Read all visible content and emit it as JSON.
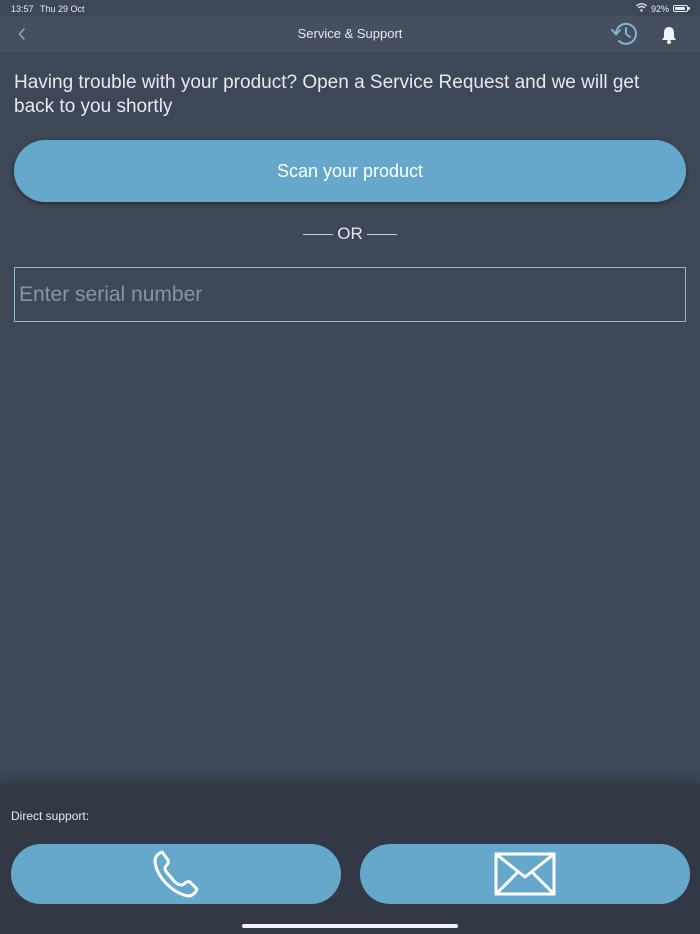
{
  "status_bar": {
    "time": "13:57",
    "date": "Thu 29 Oct",
    "battery": "92%",
    "battery_level": 0.92,
    "icons": [
      "wifi-icon",
      "battery-icon"
    ]
  },
  "nav": {
    "title": "Service & Support",
    "icons": [
      "chevron-left-icon",
      "history-icon",
      "bell-icon"
    ]
  },
  "main": {
    "intro_text": "Having trouble with your product? Open a Service Request and we will get back to you shortly",
    "scan_button_label": "Scan your product",
    "or_label": "OR",
    "serial_placeholder": "Enter serial number",
    "serial_value": ""
  },
  "footer": {
    "label": "Direct support:",
    "buttons": [
      {
        "icon": "phone-icon"
      },
      {
        "icon": "mail-icon"
      }
    ]
  },
  "colors": {
    "background": "#3e4756",
    "navbar": "#464f5e",
    "footer": "#323944",
    "accent": "#66a8cc",
    "text": "#e6e9ee"
  }
}
